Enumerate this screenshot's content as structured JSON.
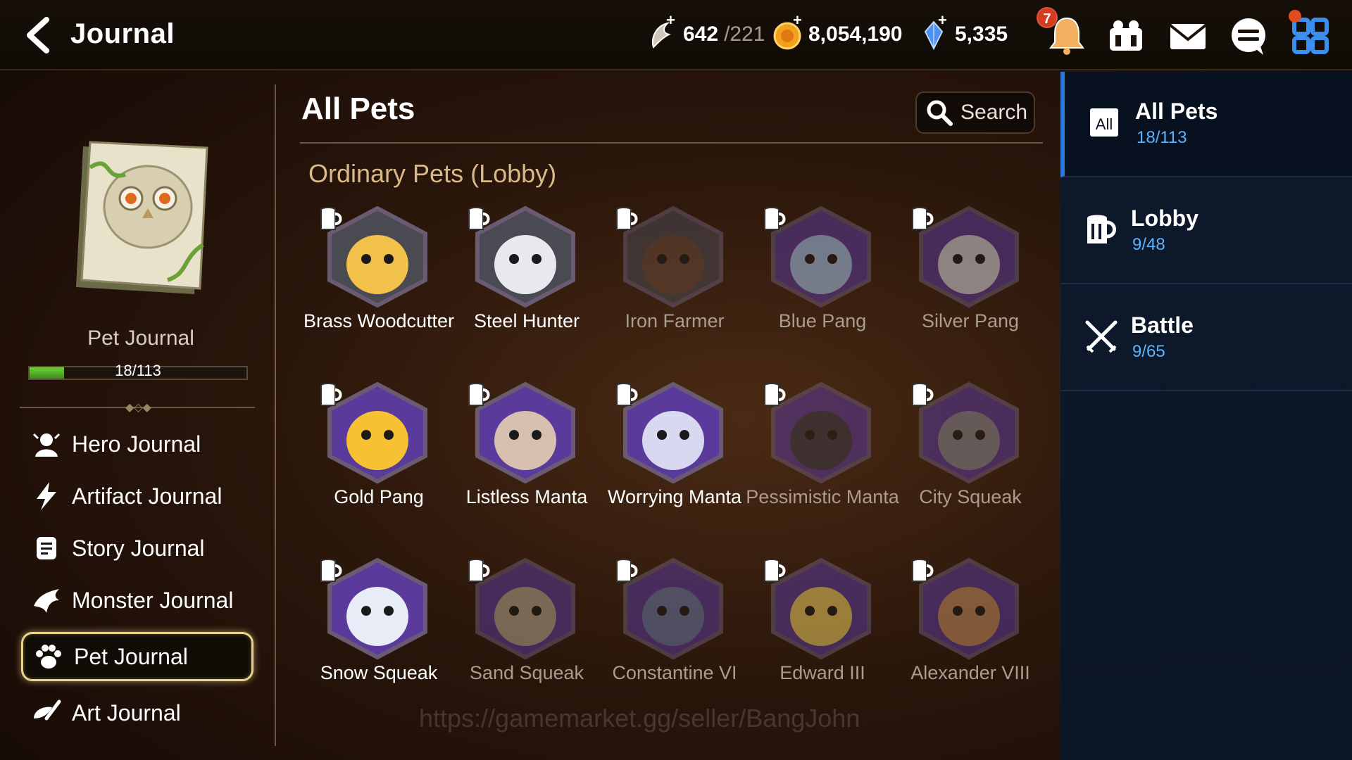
{
  "header": {
    "title": "Journal",
    "stamina": "642",
    "stamina_cap": "/221",
    "gold": "8,054,190",
    "crystals": "5,335",
    "notification_count": "7"
  },
  "sidebar": {
    "journal_name": "Pet Journal",
    "progress_text": "18/113",
    "progress_fraction": 0.16,
    "items": [
      {
        "label": "Hero Journal"
      },
      {
        "label": "Artifact Journal"
      },
      {
        "label": "Story Journal"
      },
      {
        "label": "Monster Journal"
      },
      {
        "label": "Pet Journal"
      },
      {
        "label": "Art Journal"
      }
    ]
  },
  "main": {
    "title": "All Pets",
    "search_label": "Search",
    "group_title": "Ordinary Pets (Lobby)",
    "watermark": "https://gamemarket.gg/seller/BangJohn",
    "pets": [
      {
        "name": "Brass Woodcutter",
        "owned": true
      },
      {
        "name": "Steel Hunter",
        "owned": true
      },
      {
        "name": "Iron Farmer",
        "owned": false
      },
      {
        "name": "Blue Pang",
        "owned": false
      },
      {
        "name": "Silver Pang",
        "owned": false
      },
      {
        "name": "Gold Pang",
        "owned": true
      },
      {
        "name": "Listless Manta",
        "owned": true
      },
      {
        "name": "Worrying Manta",
        "owned": true
      },
      {
        "name": "Pessimistic Manta",
        "owned": false
      },
      {
        "name": "City Squeak",
        "owned": false
      },
      {
        "name": "Snow Squeak",
        "owned": true
      },
      {
        "name": "Sand Squeak",
        "owned": false
      },
      {
        "name": "Constantine VI",
        "owned": false
      },
      {
        "name": "Edward III",
        "owned": false
      },
      {
        "name": "Alexander VIII",
        "owned": false
      }
    ]
  },
  "categories": [
    {
      "label": "All Pets",
      "count": "18/113",
      "icon_text": "All"
    },
    {
      "label": "Lobby",
      "count": "9/48"
    },
    {
      "label": "Battle",
      "count": "9/65"
    }
  ],
  "colors": {
    "accent_blue": "#5ab3ff",
    "active_border": "#e8d48a",
    "progress_green": "#6fd13a",
    "group_title": "#d9b98a"
  }
}
